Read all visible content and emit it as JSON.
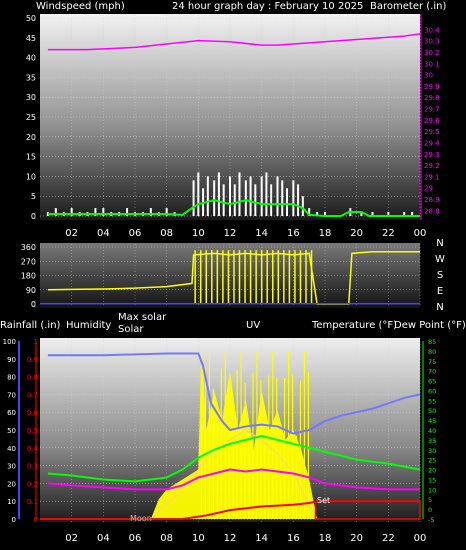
{
  "header": {
    "left_label": "Windspeed (mph)",
    "center_label": "24 hour graph day : February 10 2025",
    "right_label": "Barometer (.in)"
  },
  "colors": {
    "windspeed": "#ffffff",
    "gust_avg": "#00ff00",
    "barometer": "#ff00ff",
    "direction": "#ffff00",
    "temperature": "#ff00ff",
    "dew_point": "#00ff00",
    "humidity": "#7777ff",
    "rainfall": "#ff0000",
    "solar": "#ffff00",
    "uv": "#ffff99"
  },
  "x_ticks": [
    "02",
    "04",
    "06",
    "08",
    "10",
    "12",
    "14",
    "16",
    "18",
    "20",
    "22",
    "00"
  ],
  "compass": [
    "N",
    "W",
    "S",
    "E",
    "N"
  ],
  "bottom_labels": {
    "rainfall": "Rainfall (.in)",
    "humidity": "Humidity",
    "max_solar": "Max solar",
    "solar": "Solar",
    "uv": "UV",
    "temperature": "Temperature (°F)",
    "dew_point": "Dew Point (°F)",
    "moon": "Moon",
    "set": "Set"
  },
  "chart_data": [
    {
      "type": "line",
      "panel": "wind-barometer",
      "x_unit": "hour",
      "y_left": {
        "ticks": [
          0,
          5,
          10,
          15,
          20,
          25,
          30,
          35,
          40,
          45,
          50
        ],
        "range": [
          0,
          50
        ]
      },
      "y_right": {
        "ticks": [
          28.8,
          28.9,
          29.0,
          29.1,
          29.2,
          29.3,
          29.4,
          29.5,
          29.6,
          29.7,
          29.8,
          29.9,
          30.0,
          30.1,
          30.2,
          30.3,
          30.4
        ],
        "tick_labels": [
          "28.8",
          "28.9",
          "29",
          "29.1",
          "29.2",
          "29.3",
          "29.4",
          "29.5",
          "29.6",
          "29.7",
          "29.8",
          "29.9",
          "30",
          "30.1",
          "30.2",
          "30.3",
          "30.4"
        ],
        "range": [
          28.75,
          30.5
        ]
      },
      "series": [
        {
          "axis": "right",
          "points": [
            [
              0.5,
              30.22
            ],
            [
              3,
              30.22
            ],
            [
              6,
              30.24
            ],
            [
              8,
              30.27
            ],
            [
              10,
              30.3
            ],
            [
              12,
              30.29
            ],
            [
              14,
              30.26
            ],
            [
              15,
              30.26
            ],
            [
              17,
              30.28
            ],
            [
              19,
              30.3
            ],
            [
              21,
              30.32
            ],
            [
              23,
              30.34
            ],
            [
              24,
              30.36
            ]
          ]
        },
        {
          "axis": "left",
          "points": [
            [
              0.5,
              0.5
            ],
            [
              4,
              0.5
            ],
            [
              8,
              0.5
            ],
            [
              9,
              0.3
            ],
            [
              9.6,
              2
            ],
            [
              10,
              3
            ],
            [
              11,
              4
            ],
            [
              12,
              3
            ],
            [
              13,
              4
            ],
            [
              14,
              3
            ],
            [
              15,
              3
            ],
            [
              16,
              3
            ],
            [
              16.6,
              2
            ],
            [
              17,
              0.3
            ],
            [
              18,
              0
            ],
            [
              19,
              0
            ],
            [
              19.5,
              1
            ],
            [
              20.3,
              1
            ],
            [
              20.8,
              0
            ],
            [
              24,
              0
            ]
          ]
        },
        {
          "axis": "left",
          "style": "bars",
          "points": [
            [
              0.5,
              1
            ],
            [
              1,
              2
            ],
            [
              1.5,
              1
            ],
            [
              2,
              2
            ],
            [
              2.5,
              1
            ],
            [
              3,
              1
            ],
            [
              3.5,
              2
            ],
            [
              4,
              2
            ],
            [
              4.5,
              1
            ],
            [
              5,
              1
            ],
            [
              5.5,
              2
            ],
            [
              6,
              1
            ],
            [
              6.5,
              1
            ],
            [
              7,
              2
            ],
            [
              7.5,
              1
            ],
            [
              8,
              2
            ],
            [
              8.5,
              1
            ],
            [
              9.7,
              9
            ],
            [
              10,
              11
            ],
            [
              10.3,
              7
            ],
            [
              10.6,
              10
            ],
            [
              11,
              9
            ],
            [
              11.3,
              11
            ],
            [
              11.6,
              8
            ],
            [
              12,
              10
            ],
            [
              12.3,
              8
            ],
            [
              12.6,
              11
            ],
            [
              13,
              9
            ],
            [
              13.3,
              10
            ],
            [
              13.6,
              8
            ],
            [
              14,
              10
            ],
            [
              14.3,
              11
            ],
            [
              14.6,
              8
            ],
            [
              15,
              10
            ],
            [
              15.3,
              9
            ],
            [
              15.6,
              7
            ],
            [
              16,
              9
            ],
            [
              16.3,
              8
            ],
            [
              16.6,
              5
            ],
            [
              17,
              2
            ],
            [
              17.5,
              1
            ],
            [
              18,
              1
            ],
            [
              19.6,
              2
            ],
            [
              20.3,
              1
            ],
            [
              21,
              1
            ],
            [
              22,
              1
            ],
            [
              23,
              1
            ],
            [
              23.5,
              1
            ]
          ]
        }
      ]
    },
    {
      "type": "scatter",
      "panel": "wind-direction",
      "y": {
        "ticks": [
          0,
          90,
          180,
          270,
          360
        ],
        "range": [
          0,
          360
        ]
      },
      "series": [
        {
          "points": [
            [
              0.5,
              90
            ],
            [
              2,
              92
            ],
            [
              4,
              95
            ],
            [
              6,
              100
            ],
            [
              8,
              110
            ],
            [
              9.6,
              130
            ],
            [
              9.7,
              310
            ],
            [
              11,
              320
            ],
            [
              12,
              310
            ],
            [
              13,
              320
            ],
            [
              14,
              310
            ],
            [
              15,
              320
            ],
            [
              16,
              310
            ],
            [
              17,
              320
            ],
            [
              17.5,
              0
            ],
            [
              19.5,
              0
            ],
            [
              19.7,
              320
            ],
            [
              21,
              330
            ],
            [
              22,
              330
            ],
            [
              23,
              330
            ],
            [
              24,
              330
            ]
          ]
        },
        {
          "points": [
            [
              0,
              2
            ],
            [
              24,
              2
            ]
          ]
        }
      ]
    },
    {
      "type": "line",
      "panel": "temperature-humidity-solar",
      "y_rain": {
        "ticks": [
          0,
          0.1,
          0.2,
          0.3,
          0.4,
          0.5,
          0.6,
          0.7,
          0.8,
          0.9,
          1
        ],
        "range": [
          0,
          1
        ]
      },
      "y_humidity": {
        "ticks": [
          0,
          10,
          20,
          30,
          40,
          50,
          60,
          70,
          80,
          90,
          100
        ],
        "range": [
          0,
          100
        ]
      },
      "y_temp": {
        "ticks": [
          -5,
          0,
          5,
          10,
          15,
          20,
          25,
          30,
          35,
          40,
          45,
          50,
          55,
          60,
          65,
          70,
          75,
          80,
          85
        ],
        "range": [
          -5,
          85
        ]
      },
      "series": [
        {
          "name": "Humidity",
          "axis": "humidity",
          "points": [
            [
              0.5,
              92
            ],
            [
              4,
              92
            ],
            [
              8,
              93
            ],
            [
              10,
              93
            ],
            [
              10.3,
              86
            ],
            [
              10.8,
              65
            ],
            [
              11.5,
              55
            ],
            [
              12,
              50
            ],
            [
              13,
              52
            ],
            [
              14,
              53
            ],
            [
              15,
              52
            ],
            [
              16,
              48
            ],
            [
              17,
              50
            ],
            [
              18,
              55
            ],
            [
              19,
              58
            ],
            [
              20,
              60
            ],
            [
              21,
              62
            ],
            [
              22,
              65
            ],
            [
              23,
              68
            ],
            [
              24,
              70
            ]
          ]
        },
        {
          "name": "Temperature (°F)",
          "axis": "temp",
          "points": [
            [
              0.5,
              13
            ],
            [
              2,
              12
            ],
            [
              4,
              11
            ],
            [
              6,
              10
            ],
            [
              8,
              10
            ],
            [
              9,
              12
            ],
            [
              10,
              16
            ],
            [
              11,
              18
            ],
            [
              12,
              20
            ],
            [
              13,
              19
            ],
            [
              14,
              20
            ],
            [
              15,
              19
            ],
            [
              16,
              18
            ],
            [
              17,
              16
            ],
            [
              18,
              13
            ],
            [
              19,
              12
            ],
            [
              20,
              11
            ],
            [
              22,
              10
            ],
            [
              24,
              10
            ]
          ]
        },
        {
          "name": "Dew Point (°F)",
          "axis": "temp",
          "points": [
            [
              0.5,
              18
            ],
            [
              2,
              17
            ],
            [
              4,
              15
            ],
            [
              6,
              14
            ],
            [
              8,
              16
            ],
            [
              9,
              20
            ],
            [
              10,
              26
            ],
            [
              11,
              30
            ],
            [
              12,
              33
            ],
            [
              13,
              35
            ],
            [
              14,
              37
            ],
            [
              15,
              35
            ],
            [
              16,
              33
            ],
            [
              17,
              31
            ],
            [
              18,
              29
            ],
            [
              19,
              27
            ],
            [
              20,
              25
            ],
            [
              22,
              23
            ],
            [
              24,
              20
            ]
          ]
        },
        {
          "name": "Rainfall (.in)",
          "axis": "rain",
          "points": [
            [
              0,
              0
            ],
            [
              9,
              0
            ],
            [
              10.5,
              0.02
            ],
            [
              12,
              0.05
            ],
            [
              14,
              0.07
            ],
            [
              16,
              0.08
            ],
            [
              17,
              0.09
            ],
            [
              17.5,
              0.1
            ],
            [
              24,
              0.1
            ]
          ]
        },
        {
          "name": "Solar",
          "axis": "temp",
          "style": "filled",
          "points": [
            [
              7,
              -5
            ],
            [
              7.5,
              5
            ],
            [
              8,
              10
            ],
            [
              9,
              15
            ],
            [
              10,
              20
            ],
            [
              10.2,
              85
            ],
            [
              10.5,
              40
            ],
            [
              11,
              60
            ],
            [
              11.5,
              45
            ],
            [
              12,
              70
            ],
            [
              12.5,
              40
            ],
            [
              13,
              55
            ],
            [
              13.5,
              30
            ],
            [
              14,
              60
            ],
            [
              14.5,
              40
            ],
            [
              15,
              50
            ],
            [
              15.5,
              35
            ],
            [
              16,
              40
            ],
            [
              16.5,
              30
            ],
            [
              17,
              15
            ],
            [
              17.5,
              -5
            ]
          ]
        },
        {
          "name": "Max solar",
          "axis": "temp",
          "points": [
            [
              7,
              -5
            ],
            [
              9,
              10
            ],
            [
              10.5,
              25
            ],
            [
              12,
              35
            ],
            [
              13,
              40
            ],
            [
              14,
              35
            ],
            [
              15,
              28
            ],
            [
              16,
              18
            ],
            [
              17.5,
              -5
            ]
          ]
        }
      ]
    }
  ]
}
